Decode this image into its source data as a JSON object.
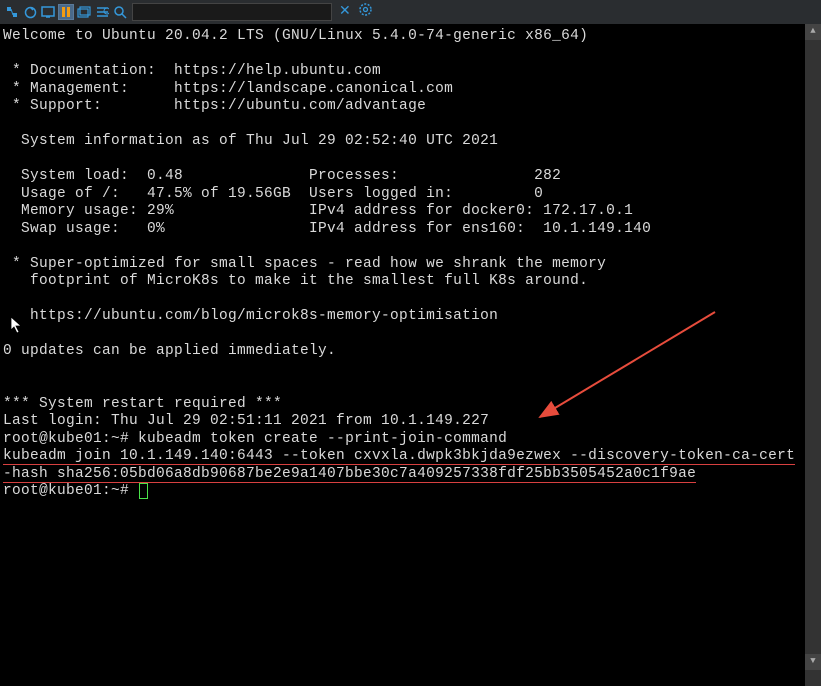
{
  "toolbar": {
    "search_placeholder": "",
    "search_value": ""
  },
  "terminal": {
    "lines": [
      "Welcome to Ubuntu 20.04.2 LTS (GNU/Linux 5.4.0-74-generic x86_64)",
      "",
      " * Documentation:  https://help.ubuntu.com",
      " * Management:     https://landscape.canonical.com",
      " * Support:        https://ubuntu.com/advantage",
      "",
      "  System information as of Thu Jul 29 02:52:40 UTC 2021",
      "",
      "  System load:  0.48              Processes:               282",
      "  Usage of /:   47.5% of 19.56GB  Users logged in:         0",
      "  Memory usage: 29%               IPv4 address for docker0: 172.17.0.1",
      "  Swap usage:   0%                IPv4 address for ens160:  10.1.149.140",
      "",
      " * Super-optimized for small spaces - read how we shrank the memory",
      "   footprint of MicroK8s to make it the smallest full K8s around.",
      "",
      "   https://ubuntu.com/blog/microk8s-memory-optimisation",
      "",
      "0 updates can be applied immediately.",
      "",
      "",
      "*** System restart required ***",
      "Last login: Thu Jul 29 02:51:11 2021 from 10.1.149.227"
    ],
    "prompt1_prefix": "root@kube01:~# ",
    "prompt1_command": "kubeadm token create --print-join-command",
    "highlighted_line1": "kubeadm join 10.1.149.140:6443 --token cxvxla.dwpk3bkjda9ezwex --discovery-token-ca-cert",
    "highlighted_line2": "-hash sha256:05bd06a8db90687be2e9a1407bbe30c7a409257338fdf25bb3505452a0c1f9ae",
    "prompt2": "root@kube01:~# "
  }
}
